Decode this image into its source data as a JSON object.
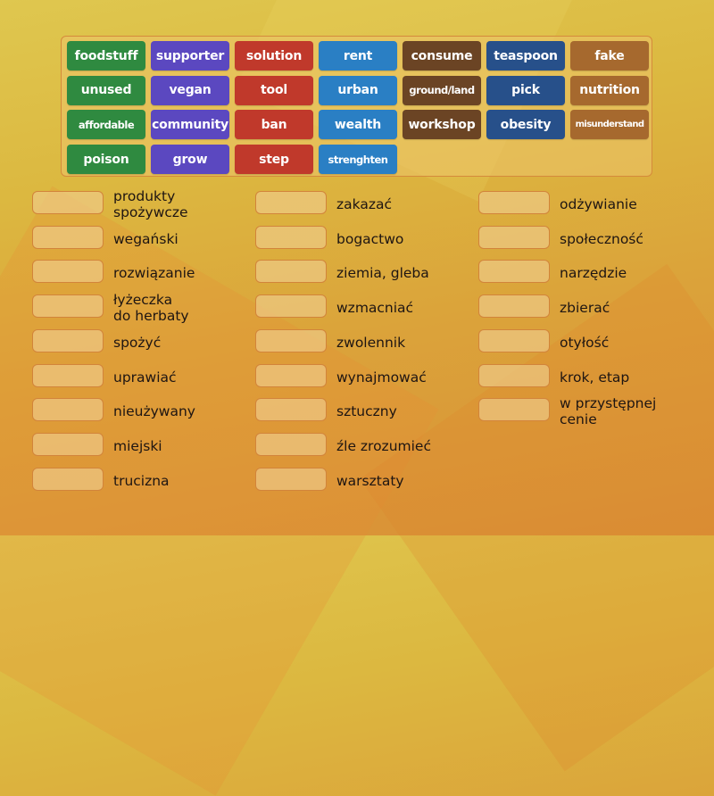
{
  "tiles": [
    {
      "text": "foodstuff",
      "color": "#2f8a40"
    },
    {
      "text": "supporter",
      "color": "#5b48c0"
    },
    {
      "text": "solution",
      "color": "#c0392b"
    },
    {
      "text": "rent",
      "color": "#2a7fc4"
    },
    {
      "text": "consume",
      "color": "#6b4424"
    },
    {
      "text": "teaspoon",
      "color": "#27508a"
    },
    {
      "text": "fake",
      "color": "#a6692e"
    },
    {
      "text": "unused",
      "color": "#2f8a40"
    },
    {
      "text": "vegan",
      "color": "#5b48c0"
    },
    {
      "text": "tool",
      "color": "#c0392b"
    },
    {
      "text": "urban",
      "color": "#2a7fc4"
    },
    {
      "text": "ground/land",
      "color": "#6b4424"
    },
    {
      "text": "pick",
      "color": "#27508a"
    },
    {
      "text": "nutrition",
      "color": "#a6692e"
    },
    {
      "text": "affordable",
      "color": "#2f8a40"
    },
    {
      "text": "community",
      "color": "#5b48c0"
    },
    {
      "text": "ban",
      "color": "#c0392b"
    },
    {
      "text": "wealth",
      "color": "#2a7fc4"
    },
    {
      "text": "workshop",
      "color": "#6b4424"
    },
    {
      "text": "obesity",
      "color": "#27508a"
    },
    {
      "text": "misunderstand",
      "color": "#a6692e"
    },
    {
      "text": "poison",
      "color": "#2f8a40"
    },
    {
      "text": "grow",
      "color": "#5b48c0"
    },
    {
      "text": "step",
      "color": "#c0392b"
    },
    {
      "text": "strenghten",
      "color": "#2a7fc4"
    }
  ],
  "targets": {
    "col1": [
      "produkty\nspożywcze",
      "wegański",
      "rozwiązanie",
      "łyżeczka\ndo herbaty",
      "spożyć",
      "uprawiać",
      "nieużywany",
      "miejski",
      "trucizna"
    ],
    "col2": [
      "zakazać",
      "bogactwo",
      "ziemia, gleba",
      "wzmacniać",
      "zwolennik",
      "wynajmować",
      "sztuczny",
      "źle zrozumieć",
      "warsztaty"
    ],
    "col3": [
      "odżywianie",
      "społeczność",
      "narzędzie",
      "zbierać",
      "otyłość",
      "krok, etap",
      "w przystępnej\ncenie"
    ]
  }
}
